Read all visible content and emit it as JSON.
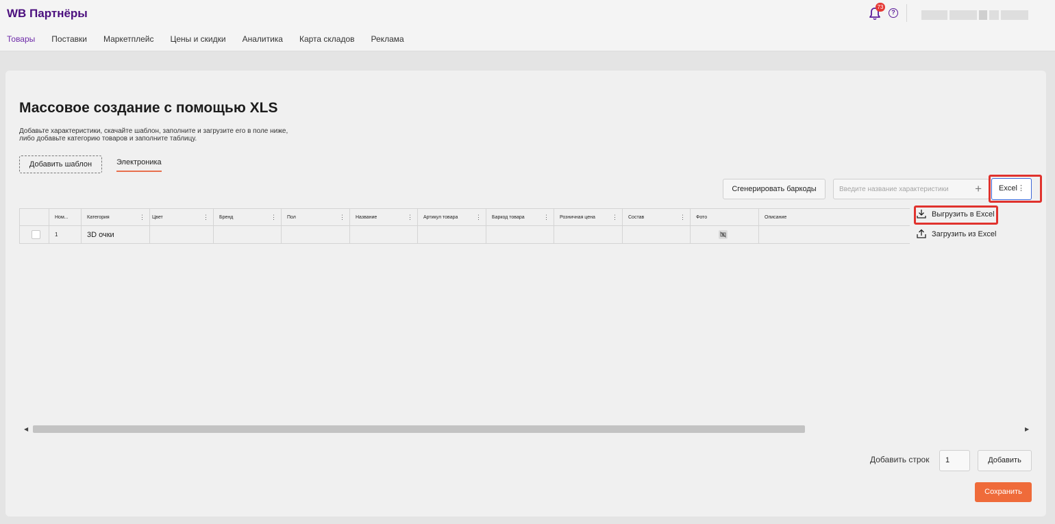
{
  "header": {
    "brand": "WB Партнёры",
    "notification_count": "73",
    "help_glyph": "?",
    "nav": [
      "Товары",
      "Поставки",
      "Маркетплейс",
      "Цены и скидки",
      "Аналитика",
      "Карта складов",
      "Реклама"
    ],
    "active_nav": "Товары"
  },
  "page": {
    "title": "Массовое создание с помощью XLS",
    "description": "Добавьте характеристики, скачайте шаблон, заполните и загрузите его в поле ниже, либо добавьте категорию товаров и заполните таблицу.",
    "add_template_label": "Добавить шаблон",
    "category_tab": "Электроника"
  },
  "toolbar": {
    "generate_barcodes_label": "Сгенерировать баркоды",
    "characteristic_placeholder": "Введите название характеристики",
    "plus_glyph": "+",
    "excel_label": "Excel",
    "menu_dots": "⋮"
  },
  "excel_menu": {
    "export_label": "Выгрузить в Excel",
    "import_label": "Загрузить из Excel"
  },
  "table": {
    "columns": [
      "Ном...",
      "Категория",
      "Цвет",
      "Бренд",
      "Пол",
      "Название",
      "Артикул товара",
      "Баркод товара",
      "Розничная цена",
      "Состав",
      "Фото",
      "Описание"
    ],
    "rows": [
      {
        "num": "1",
        "category": "3D очки"
      }
    ]
  },
  "scrollbar": {
    "left_arrow": "◀",
    "right_arrow": "▶"
  },
  "footer": {
    "add_rows_label": "Добавить строк",
    "add_rows_value": "1",
    "add_button_label": "Добавить",
    "save_button_label": "Сохранить"
  },
  "colors": {
    "brand": "#4b0f7e",
    "accent": "#ef6b3a",
    "highlight": "#e0322d",
    "focus": "#3c66d8"
  }
}
